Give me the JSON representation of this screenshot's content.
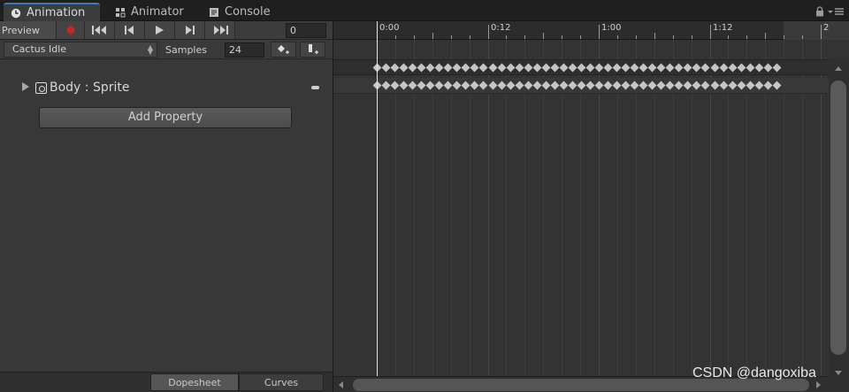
{
  "tabs": [
    {
      "label": "Animation",
      "icon": "clock-icon",
      "active": true
    },
    {
      "label": "Animator",
      "icon": "animator-icon",
      "active": false
    },
    {
      "label": "Console",
      "icon": "console-icon",
      "active": false
    }
  ],
  "toolbar": {
    "preview_label": "Preview",
    "record_icon": "record-icon",
    "frame_value": "0"
  },
  "clip": {
    "selected": "Cactus Idle",
    "samples_label": "Samples",
    "samples_value": "24"
  },
  "properties": [
    {
      "label": "Body : Sprite",
      "icon": "sprite-renderer-icon"
    }
  ],
  "add_property_label": "Add Property",
  "view_tabs": {
    "dopesheet": "Dopesheet",
    "curves": "Curves",
    "active": "dopesheet"
  },
  "timeline": {
    "ruler_labels": [
      "0:00",
      "0:12",
      "1:00",
      "1:12",
      "2"
    ],
    "keyframes_per_row": 46
  },
  "watermark": "CSDN @dangoxiba",
  "colors": {
    "record": "#c62828",
    "accent": "#3a79bb",
    "keyframe": "#c5c5c5"
  }
}
